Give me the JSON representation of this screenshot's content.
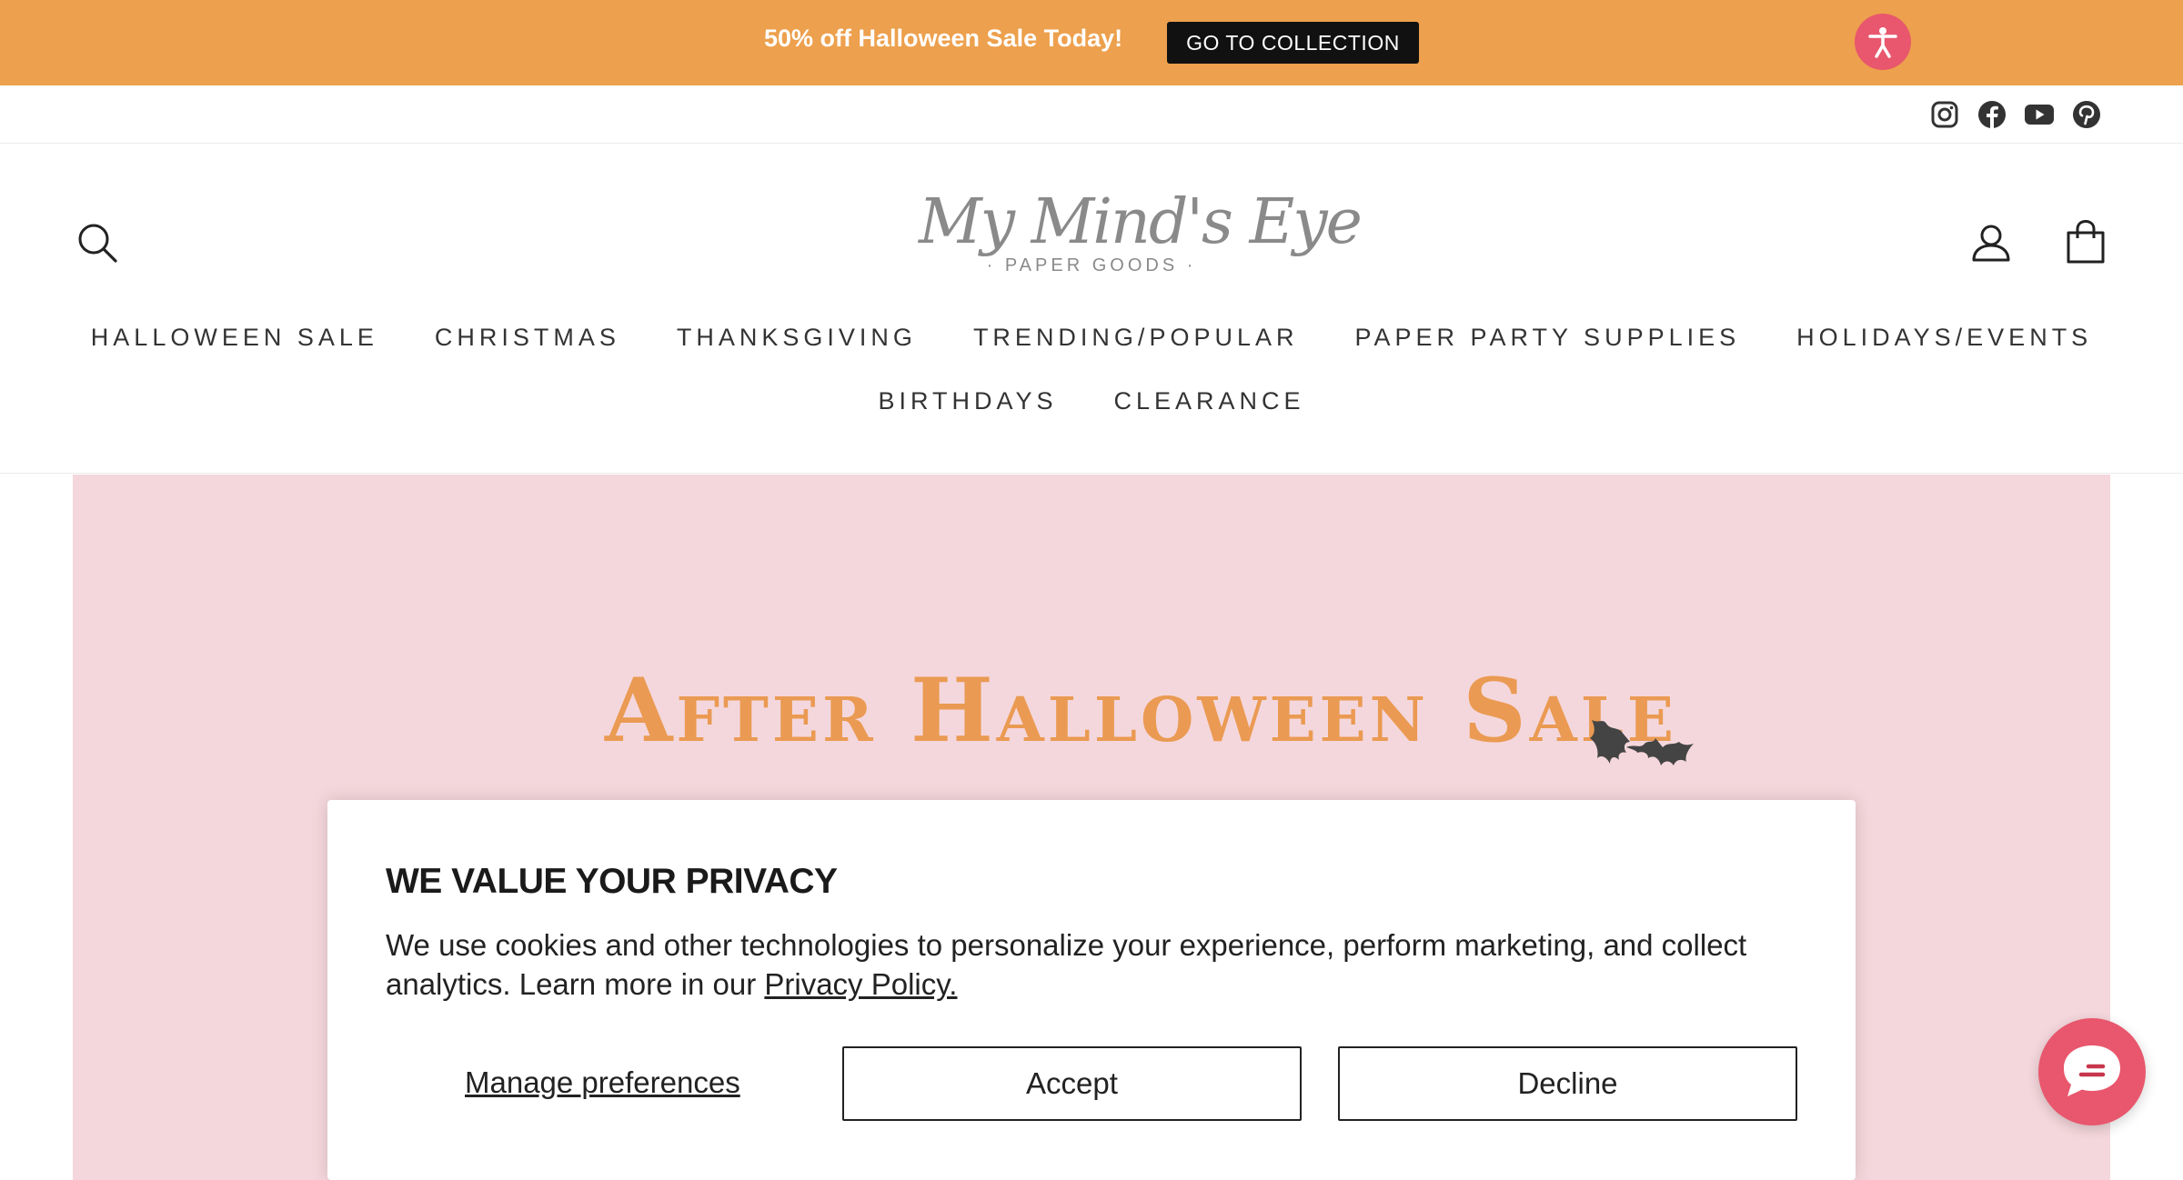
{
  "announcement": {
    "text": "50% off Halloween Sale Today!",
    "button_label": "GO TO COLLECTION",
    "background_color": "#EDA04D",
    "accessibility_icon": "accessibility-person-icon"
  },
  "social": [
    {
      "name": "instagram-icon"
    },
    {
      "name": "facebook-icon"
    },
    {
      "name": "youtube-icon"
    },
    {
      "name": "pinterest-icon"
    }
  ],
  "header": {
    "logo_script": "My Mind's Eye",
    "logo_sub": "· PAPER GOODS ·",
    "search_icon": "search-icon",
    "account_icon": "account-icon",
    "cart_icon": "cart-bag-icon"
  },
  "nav": {
    "row1": [
      "HALLOWEEN SALE",
      "CHRISTMAS",
      "THANKSGIVING",
      "TRENDING/POPULAR",
      "PAPER PARTY SUPPLIES",
      "HOLIDAYS/EVENTS"
    ],
    "row2": [
      "BIRTHDAYS",
      "CLEARANCE"
    ]
  },
  "hero": {
    "title": "After Halloween Sale",
    "background_color": "#F4D7DC",
    "title_color": "#EA9A52",
    "decoration_icon": "bats-icon"
  },
  "cookie": {
    "title": "WE VALUE YOUR PRIVACY",
    "body": "We use cookies and other technologies to personalize your experience, perform marketing, and collect analytics. Learn more in our ",
    "link": "Privacy Policy.",
    "manage_label": "Manage preferences",
    "accept_label": "Accept",
    "decline_label": "Decline"
  },
  "chat": {
    "icon": "chat-bubble-icon",
    "color": "#E8576D"
  }
}
